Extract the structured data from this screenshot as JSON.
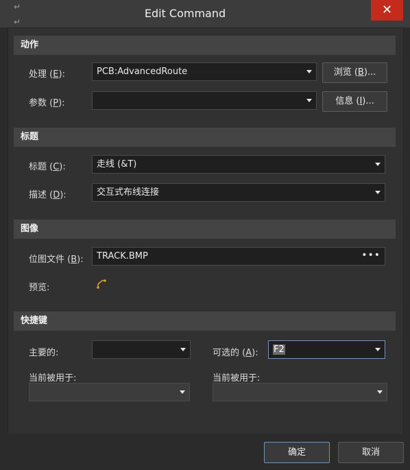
{
  "window": {
    "title": "Edit Command",
    "close_symbol": "✕"
  },
  "sections": {
    "action": "动作",
    "caption": "标题",
    "image": "图像",
    "shortcut": "快捷键"
  },
  "action": {
    "process": {
      "label_pre": "处理 (",
      "key": "E",
      "label_post": "):",
      "value": "PCB:AdvancedRoute"
    },
    "params": {
      "label_pre": "参数 (",
      "key": "P",
      "label_post": "):",
      "value": ""
    },
    "browse_button": {
      "pre": "浏览 (",
      "key": "B",
      "post": ")..."
    },
    "info_button": {
      "pre": "信息 (",
      "key": "I",
      "post": ")..."
    }
  },
  "caption": {
    "caption_field": {
      "label_pre": "标题 (",
      "key": "C",
      "label_post": "):",
      "value": "走线 (&T)"
    },
    "description_field": {
      "label_pre": "描述 (",
      "key": "D",
      "label_post": "):",
      "value": "交互式布线连接"
    }
  },
  "image": {
    "bitmap": {
      "label_pre": "位图文件 (",
      "key": "B",
      "label_post": "):",
      "value": "TRACK.BMP",
      "browse_glyph": "•••"
    },
    "preview_label": "预览:"
  },
  "shortcut": {
    "primary": {
      "label": "主要的:",
      "value": ""
    },
    "alternate": {
      "label_pre": "可选的 (",
      "key": "A",
      "label_post": "):",
      "value": "F2"
    },
    "primary_used_by": {
      "label": "当前被用于:",
      "value": ""
    },
    "alternate_used_by": {
      "label": "当前被用于:",
      "value": ""
    }
  },
  "footer": {
    "ok": "确定",
    "cancel": "取消"
  },
  "colors": {
    "close": "#c42b1c",
    "accent_border": "#7a93b8",
    "icon": "#e0a030"
  }
}
